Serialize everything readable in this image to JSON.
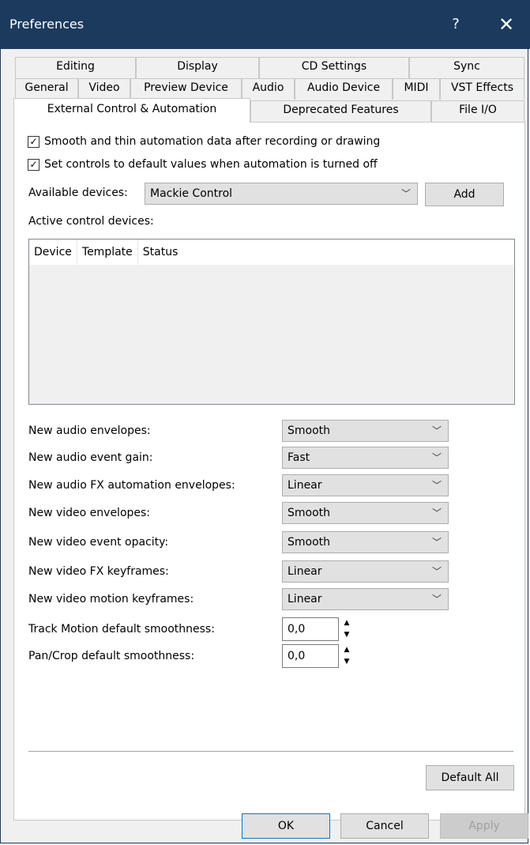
{
  "window": {
    "title": "Preferences",
    "help": "?",
    "close": "✕"
  },
  "tabs": {
    "row1": [
      "Editing",
      "Display",
      "CD Settings",
      "Sync"
    ],
    "row2": [
      "General",
      "Video",
      "Preview Device",
      "Audio",
      "Audio Device",
      "MIDI",
      "VST Effects"
    ],
    "row3": [
      "External Control & Automation",
      "Deprecated Features",
      "File I/O"
    ],
    "active": "External Control & Automation"
  },
  "options": {
    "smooth_thin": {
      "label": "Smooth and thin automation data after recording or drawing",
      "checked": true
    },
    "default_values": {
      "label": "Set controls to default values when automation is turned off",
      "checked": true
    }
  },
  "devices": {
    "available_label": "Available devices:",
    "available_value": "Mackie Control",
    "add_label": "Add",
    "active_label": "Active control devices:",
    "columns": [
      "Device",
      "Template",
      "Status"
    ]
  },
  "settings": [
    {
      "label": "New audio envelopes:",
      "value": "Smooth"
    },
    {
      "label": "New audio event gain:",
      "value": "Fast"
    },
    {
      "label": "New audio FX automation envelopes:",
      "value": "Linear"
    },
    {
      "label": "New video envelopes:",
      "value": "Smooth"
    },
    {
      "label": "New video event opacity:",
      "value": "Smooth"
    },
    {
      "label": "New video FX keyframes:",
      "value": "Linear"
    },
    {
      "label": "New video motion keyframes:",
      "value": "Linear"
    }
  ],
  "smoothness": [
    {
      "label": "Track Motion default smoothness:",
      "value": "0,0"
    },
    {
      "label": "Pan/Crop default smoothness:",
      "value": "0,0"
    }
  ],
  "buttons": {
    "default_all": "Default All",
    "ok": "OK",
    "cancel": "Cancel",
    "apply": "Apply"
  },
  "icons": {
    "chevron": "chevron-down-icon",
    "check": "check-icon"
  }
}
